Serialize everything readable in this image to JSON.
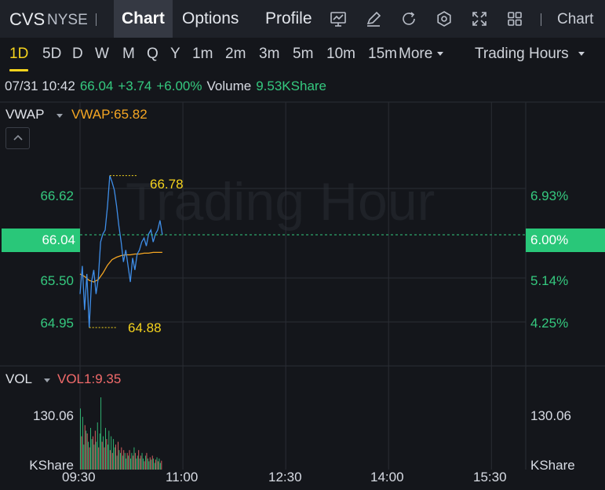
{
  "header": {
    "ticker": "CVS",
    "exchange": "NYSE",
    "tabs": [
      {
        "label": "Chart",
        "active": true
      },
      {
        "label": "Options",
        "active": false
      },
      {
        "label": "Profile",
        "active": false
      }
    ],
    "icons": [
      "indicator-icon",
      "draw-icon",
      "refresh-icon",
      "settings-icon",
      "fullscreen-icon",
      "layout-grid-icon"
    ],
    "right_label": "Chart"
  },
  "periods": {
    "items": [
      "1D",
      "5D",
      "D",
      "W",
      "M",
      "Q",
      "Y",
      "1m",
      "2m",
      "3m",
      "5m",
      "10m",
      "15m"
    ],
    "active": "1D",
    "more_label": "More",
    "session_label": "Trading Hours"
  },
  "quote": {
    "datetime": "07/31 10:42",
    "price": "66.04",
    "change": "+3.74",
    "change_pct": "+6.00%",
    "volume_label": "Volume",
    "volume_value": "9.53KShare"
  },
  "price_panel": {
    "indicator": "VWAP",
    "indicator_value": "VWAP:65.82",
    "watermark": "Trading Hour",
    "left_labels": [
      "66.62",
      "65.50",
      "64.95"
    ],
    "right_labels": [
      "6.93%",
      "5.14%",
      "4.25%"
    ],
    "current_price": "66.04",
    "current_pct": "6.00%",
    "high_label": "66.78",
    "low_label": "64.88"
  },
  "volume_panel": {
    "indicator": "VOL",
    "indicator_value": "VOL1:9.35",
    "left_max": "130.06",
    "right_max": "130.06",
    "unit_left": "KShare",
    "unit_right": "KShare"
  },
  "x_axis": [
    "09:30",
    "11:00",
    "12:30",
    "14:00",
    "15:30"
  ],
  "colors": {
    "up": "#35c97f",
    "down": "#f36b6b",
    "vwap": "#f5a623",
    "price_line": "#3f8ee8",
    "accent": "#f5d31d"
  },
  "chart_data": {
    "type": "line",
    "session": "09:30-16:00",
    "price": {
      "time": [
        "09:30",
        "09:32",
        "09:34",
        "09:36",
        "09:38",
        "09:40",
        "09:42",
        "09:44",
        "09:46",
        "09:48",
        "09:50",
        "09:52",
        "09:54",
        "09:56",
        "09:58",
        "10:00",
        "10:02",
        "10:04",
        "10:06",
        "10:08",
        "10:10",
        "10:12",
        "10:14",
        "10:16",
        "10:18",
        "10:20",
        "10:22",
        "10:24",
        "10:26",
        "10:28",
        "10:30",
        "10:32",
        "10:34",
        "10:36",
        "10:38",
        "10:40",
        "10:42"
      ],
      "values": [
        65.3,
        65.65,
        65.1,
        65.55,
        64.88,
        65.45,
        65.6,
        65.3,
        65.5,
        65.95,
        66.05,
        66.1,
        66.4,
        66.78,
        66.7,
        66.6,
        66.4,
        66.15,
        65.95,
        65.7,
        65.85,
        65.65,
        65.45,
        65.75,
        65.6,
        65.8,
        65.85,
        65.95,
        66.0,
        65.9,
        66.05,
        66.1,
        65.95,
        66.05,
        66.1,
        66.22,
        66.04
      ],
      "high": 66.78,
      "low": 64.88
    },
    "vwap": {
      "time": [
        "09:30",
        "09:34",
        "09:38",
        "09:42",
        "09:46",
        "09:50",
        "09:54",
        "09:58",
        "10:02",
        "10:06",
        "10:10",
        "10:14",
        "10:18",
        "10:22",
        "10:26",
        "10:30",
        "10:34",
        "10:38",
        "10:42"
      ],
      "values": [
        65.55,
        65.52,
        65.47,
        65.45,
        65.48,
        65.56,
        65.66,
        65.73,
        65.76,
        65.78,
        65.79,
        65.79,
        65.8,
        65.8,
        65.81,
        65.81,
        65.82,
        65.82,
        65.82
      ]
    },
    "volume": {
      "unit": "KShare",
      "values": [
        110,
        60,
        95,
        45,
        80,
        70,
        65,
        50,
        40,
        75,
        55,
        60,
        45,
        70,
        50,
        85,
        40,
        65,
        130,
        50,
        60,
        40,
        75,
        55,
        45,
        70,
        35,
        60,
        30,
        55,
        40,
        45,
        25,
        50,
        35,
        30,
        40,
        25,
        35,
        30,
        20,
        30,
        25,
        35,
        20,
        30,
        25,
        40,
        30,
        20,
        25,
        35,
        20,
        25,
        30,
        20,
        15,
        25,
        30,
        20,
        15,
        22,
        18,
        25,
        20,
        12,
        18,
        22,
        15,
        20,
        12,
        16
      ],
      "up": [
        1,
        0,
        1,
        1,
        0,
        1,
        0,
        1,
        0,
        1,
        1,
        0,
        1,
        0,
        1,
        1,
        0,
        1,
        1,
        0,
        1,
        0,
        1,
        0,
        1,
        1,
        0,
        1,
        0,
        1,
        1,
        0,
        1,
        0,
        1,
        1,
        0,
        1,
        0,
        1,
        1,
        0,
        1,
        0,
        1,
        1,
        0,
        1,
        0,
        1,
        1,
        0,
        1,
        0,
        1,
        1,
        0,
        1,
        0,
        1,
        1,
        0,
        1,
        0,
        1,
        1,
        0,
        1,
        0,
        1,
        1,
        0
      ],
      "max_label": 130.06
    },
    "ylim_price": [
      64.4,
      67.7
    ]
  }
}
